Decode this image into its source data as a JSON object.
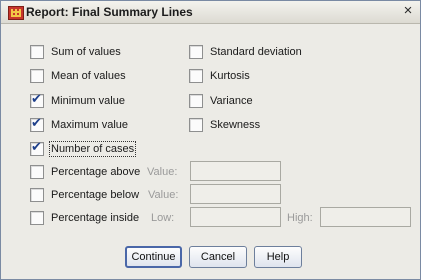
{
  "window": {
    "title": "Report: Final Summary Lines",
    "close_glyph": "×",
    "app_icon": "table-icon"
  },
  "statistics_left": [
    {
      "label": "Sum of values",
      "checked": false
    },
    {
      "label": "Mean of values",
      "checked": false
    },
    {
      "label": "Minimum value",
      "checked": true
    },
    {
      "label": "Maximum value",
      "checked": true
    },
    {
      "label": "Number of cases",
      "checked": true
    }
  ],
  "statistics_right": [
    {
      "label": "Standard deviation",
      "checked": false
    },
    {
      "label": "Kurtosis",
      "checked": false
    },
    {
      "label": "Variance",
      "checked": false
    },
    {
      "label": "Skewness",
      "checked": false
    }
  ],
  "percentage_above": {
    "label": "Percentage above",
    "checked": false,
    "value_label": "Value:",
    "value": ""
  },
  "percentage_below": {
    "label": "Percentage below",
    "checked": false,
    "value_label": "Value:",
    "value": ""
  },
  "percentage_inside": {
    "label": "Percentage inside",
    "checked": false,
    "low_label": "Low:",
    "low": "",
    "high_label": "High:",
    "high": ""
  },
  "buttons": {
    "continue": "Continue",
    "cancel": "Cancel",
    "help": "Help"
  }
}
